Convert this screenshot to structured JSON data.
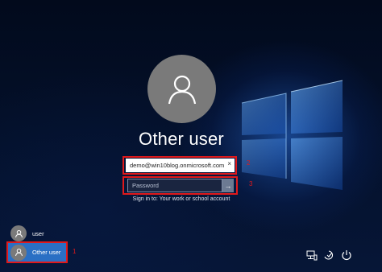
{
  "login": {
    "display_name": "Other user",
    "email_value": "demo@win10blog.onmicrosoft.com",
    "email_clear_glyph": "×",
    "password_placeholder": "Password",
    "submit_glyph": "→",
    "signin_hint": "Sign in to: Your work or school account"
  },
  "annotations": {
    "marker_1": "1",
    "marker_2": "2",
    "marker_3": "3",
    "highlight_color": "#e0191b"
  },
  "user_list": [
    {
      "label": "user",
      "selected": false
    },
    {
      "label": "Other user",
      "selected": true
    }
  ],
  "tray": {
    "icons": [
      "network-icon",
      "ease-of-access-icon",
      "power-icon"
    ]
  },
  "colors": {
    "selected_accent": "#2a6fc4",
    "avatar_gray": "#7a7a7a"
  }
}
